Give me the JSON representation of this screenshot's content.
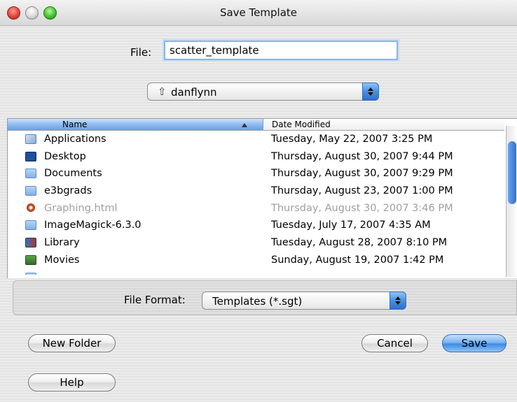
{
  "window": {
    "title": "Save Template"
  },
  "file": {
    "label": "File:",
    "value": "scatter_template"
  },
  "location": {
    "selected": "danflynn"
  },
  "browser": {
    "columns": {
      "name": "Name",
      "date": "Date Modified"
    },
    "rows": [
      {
        "name": "Applications",
        "date": "Tuesday, May 22, 2007 3:25 PM",
        "icon": "applications-folder-icon"
      },
      {
        "name": "Desktop",
        "date": "Thursday, August 30, 2007 9:44 PM",
        "icon": "desktop-folder-icon"
      },
      {
        "name": "Documents",
        "date": "Thursday, August 30, 2007 9:29 PM",
        "icon": "folder-icon"
      },
      {
        "name": "e3bgrads",
        "date": "Thursday, August 23, 2007 1:00 PM",
        "icon": "folder-icon"
      },
      {
        "name": "Graphing.html",
        "date": "Thursday, August 30, 2007 3:46 PM",
        "icon": "html-file-icon",
        "disabled": true
      },
      {
        "name": "ImageMagick-6.3.0",
        "date": "Tuesday, July 17, 2007 4:35 AM",
        "icon": "folder-icon"
      },
      {
        "name": "Library",
        "date": "Tuesday, August 28, 2007 8:10 PM",
        "icon": "library-folder-icon"
      },
      {
        "name": "Movies",
        "date": "Sunday, August 19, 2007 1:42 PM",
        "icon": "movies-folder-icon"
      }
    ]
  },
  "format": {
    "label": "File Format:",
    "selected": "Templates (*.sgt)"
  },
  "buttons": {
    "new_folder": "New Folder",
    "cancel": "Cancel",
    "save": "Save",
    "help": "Help"
  }
}
